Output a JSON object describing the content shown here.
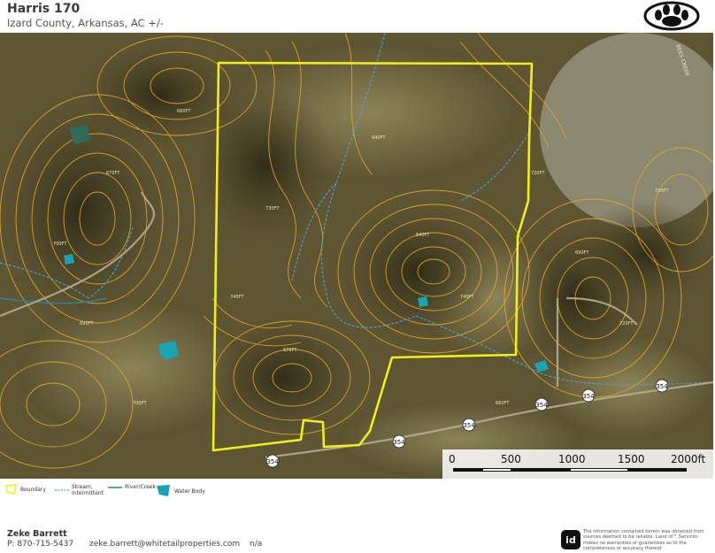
{
  "header": {
    "title": "Harris 170",
    "subtitle": "Izard County, Arkansas,  AC +/-"
  },
  "map": {
    "road_label_top": "BEES CREEK",
    "contour_labels": [
      "670FT",
      "700FT",
      "660FT",
      "730FT",
      "640FT",
      "740FT",
      "690FT",
      "720FT"
    ],
    "highway_shield": "354"
  },
  "scalebar": {
    "ticks": [
      "0",
      "500",
      "1000",
      "1500",
      "2000ft"
    ]
  },
  "legend": {
    "boundary": "Boundary",
    "stream_intermittent": "Stream, Intermittent",
    "river_creek": "River/Creek",
    "water_body": "Water Body"
  },
  "footer": {
    "agent_name": "Zeke Barrett",
    "phone": "P: 870-715-5437",
    "email": "zeke.barrett@whitetailproperties.com",
    "extra": "n/a",
    "badge": "id",
    "disclaimer": "The information contained herein was obtained from sources deemed to be reliable. Land id™ Services makes no warranties or guarantees as to the completeness or accuracy thereof."
  },
  "colors": {
    "boundary": "#f2ee1c",
    "contour": "#e6a92a",
    "stream": "#4a9fd0",
    "river": "#2d7fa8",
    "water_body": "#1aa3b3",
    "terrain_dark": "#3e3a1d",
    "terrain_light": "#8b7f55"
  }
}
